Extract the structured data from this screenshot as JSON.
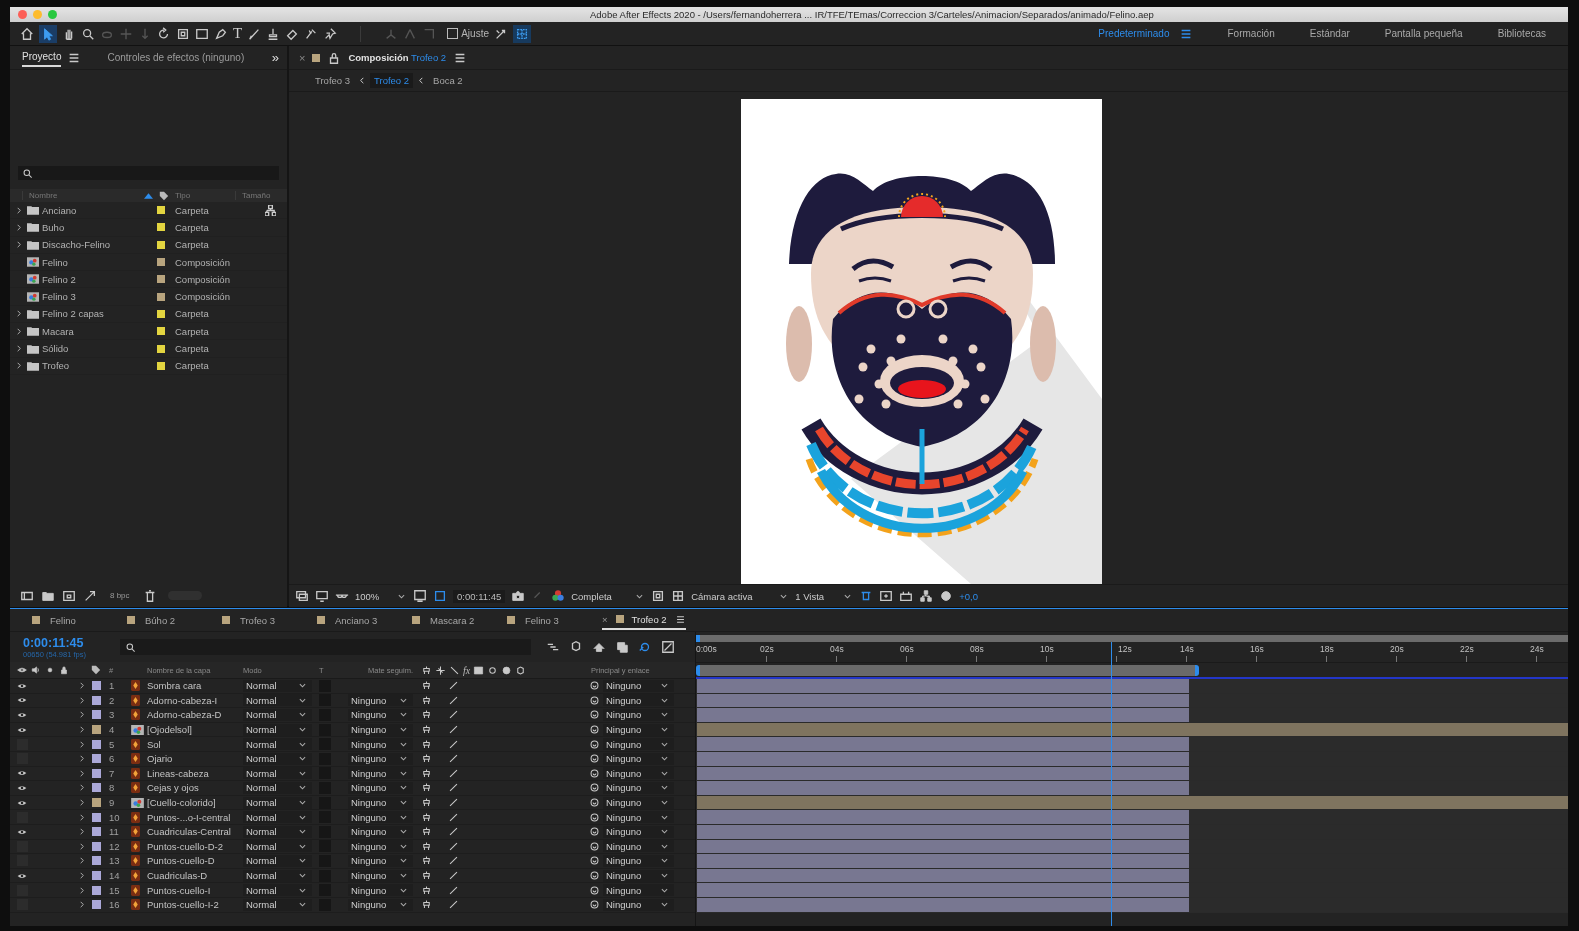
{
  "window": {
    "title": "Adobe After Effects 2020 - /Users/fernandoherrera ... IR/TFE/TEmas/Correccion 3/Carteles/Animacion/Separados/animado/Felino.aep"
  },
  "toolbar": {
    "text_tool": "T",
    "snap": {
      "label": "Ajuste",
      "checked": false
    }
  },
  "workspaces": [
    {
      "label": "Predeterminado",
      "selected": true
    },
    {
      "label": "Formación",
      "selected": false
    },
    {
      "label": "Estándar",
      "selected": false
    },
    {
      "label": "Pantalla pequeña",
      "selected": false
    },
    {
      "label": "Bibliotecas",
      "selected": false
    }
  ],
  "project_panel": {
    "tabs": [
      {
        "label": "Proyecto",
        "selected": true
      },
      {
        "label": "Controles de efectos (ninguno)",
        "selected": false
      }
    ],
    "overflow": "»",
    "columns": [
      "Nombre",
      "Tipo",
      "Tamaño"
    ],
    "items": [
      {
        "name": "Anciano",
        "kind": "folder",
        "color": "#e3d540",
        "type": "Carpeta"
      },
      {
        "name": "Buho",
        "kind": "folder",
        "color": "#e3d540",
        "type": "Carpeta"
      },
      {
        "name": "Discacho-Felino",
        "kind": "folder",
        "color": "#e3d540",
        "type": "Carpeta"
      },
      {
        "name": "Felino",
        "kind": "composition",
        "color": "#b8a47e",
        "type": "Composición"
      },
      {
        "name": "Felino 2",
        "kind": "composition",
        "color": "#b8a47e",
        "type": "Composición"
      },
      {
        "name": "Felino 3",
        "kind": "composition",
        "color": "#b8a47e",
        "type": "Composición"
      },
      {
        "name": "Felino 2 capas",
        "kind": "folder",
        "color": "#e3d540",
        "type": "Carpeta"
      },
      {
        "name": "Macara",
        "kind": "folder",
        "color": "#e3d540",
        "type": "Carpeta"
      },
      {
        "name": "Sólido",
        "kind": "folder",
        "color": "#e3d540",
        "type": "Carpeta"
      },
      {
        "name": "Trofeo",
        "kind": "folder",
        "color": "#e3d540",
        "type": "Carpeta"
      }
    ],
    "bit_depth": "8 bpc"
  },
  "composition_panel": {
    "close": "×",
    "title": "Composición",
    "name": "Trofeo 2",
    "breadcrumbs": [
      {
        "label": "Trofeo 3",
        "selected": false
      },
      {
        "label": "Trofeo 2",
        "selected": true
      },
      {
        "label": "Boca 2",
        "selected": false
      }
    ],
    "zoom": "100%",
    "timecode": "0:00:11:45",
    "resolution": "Completa",
    "camera": "Cámara activa",
    "views": "1 Vista",
    "exposure": "+0,0"
  },
  "timeline": {
    "close": "×",
    "tabs": [
      {
        "label": "Felino",
        "selected": false
      },
      {
        "label": "Búho 2",
        "selected": false
      },
      {
        "label": "Trofeo 3",
        "selected": false
      },
      {
        "label": "Anciano 3",
        "selected": false
      },
      {
        "label": "Mascara 2",
        "selected": false
      },
      {
        "label": "Felino 3",
        "selected": false
      },
      {
        "label": "Trofeo 2",
        "selected": true
      }
    ],
    "current_time": "0:00:11:45",
    "frame_info": "00650 (54.981 fps)",
    "columns": {
      "number": "#",
      "layer_name": "Nombre de la capa",
      "mode": "Modo",
      "t": "T",
      "track_matte": "Mate seguim.",
      "fx": "fx",
      "parent": "Principal y enlace"
    },
    "ruler": [
      "0:00s",
      "02s",
      "04s",
      "06s",
      "08s",
      "10s",
      "12s",
      "14s",
      "16s",
      "18s",
      "20s",
      "22s",
      "24s"
    ],
    "layers": [
      {
        "number": "1",
        "name": "Sombra cara",
        "kind": "shape",
        "visible": true,
        "color": "#aba8d8",
        "mode": "Normal",
        "parent": "Ninguno",
        "level": 0.565
      },
      {
        "number": "2",
        "name": "Adorno-cabeza-I",
        "kind": "shape",
        "visible": true,
        "color": "#aba8d8",
        "mode": "Normal",
        "track_matte": "Ninguno",
        "parent": "Ninguno",
        "level": 0.565
      },
      {
        "number": "3",
        "name": "Adorno-cabeza-D",
        "kind": "shape",
        "visible": true,
        "color": "#aba8d8",
        "mode": "Normal",
        "track_matte": "Ninguno",
        "parent": "Ninguno",
        "level": 0.565
      },
      {
        "number": "4",
        "name": "[Ojodelsol]",
        "kind": "composition",
        "visible": true,
        "color": "#b8a47e",
        "mode": "Normal",
        "track_matte": "Ninguno",
        "parent": "Ninguno",
        "level": 1
      },
      {
        "number": "5",
        "name": "Sol",
        "kind": "shape",
        "visible": false,
        "color": "#aba8d8",
        "mode": "Normal",
        "track_matte": "Ninguno",
        "parent": "Ninguno",
        "level": 0.565
      },
      {
        "number": "6",
        "name": "Ojario",
        "kind": "shape",
        "visible": false,
        "color": "#aba8d8",
        "mode": "Normal",
        "track_matte": "Ninguno",
        "parent": "Ninguno",
        "level": 0.565
      },
      {
        "number": "7",
        "name": "Lineas-cabeza",
        "kind": "shape",
        "visible": true,
        "color": "#aba8d8",
        "mode": "Normal",
        "track_matte": "Ninguno",
        "parent": "Ninguno",
        "level": 0.565
      },
      {
        "number": "8",
        "name": "Cejas y ojos",
        "kind": "shape",
        "visible": true,
        "color": "#aba8d8",
        "mode": "Normal",
        "track_matte": "Ninguno",
        "parent": "Ninguno",
        "level": 0.565
      },
      {
        "number": "9",
        "name": "[Cuello-colorido]",
        "kind": "composition",
        "visible": true,
        "color": "#b8a47e",
        "mode": "Normal",
        "track_matte": "Ninguno",
        "parent": "Ninguno",
        "level": 1
      },
      {
        "number": "10",
        "name": "Puntos-...o-I-central",
        "kind": "shape",
        "visible": false,
        "color": "#aba8d8",
        "mode": "Normal",
        "track_matte": "Ninguno",
        "parent": "Ninguno",
        "level": 0.565
      },
      {
        "number": "11",
        "name": "Cuadriculas-Central",
        "kind": "shape",
        "visible": true,
        "color": "#aba8d8",
        "mode": "Normal",
        "track_matte": "Ninguno",
        "parent": "Ninguno",
        "level": 0.565
      },
      {
        "number": "12",
        "name": "Puntos-cuello-D-2",
        "kind": "shape",
        "visible": false,
        "color": "#aba8d8",
        "mode": "Normal",
        "track_matte": "Ninguno",
        "parent": "Ninguno",
        "level": 0.565
      },
      {
        "number": "13",
        "name": "Puntos-cuello-D",
        "kind": "shape",
        "visible": false,
        "color": "#aba8d8",
        "mode": "Normal",
        "track_matte": "Ninguno",
        "parent": "Ninguno",
        "level": 0.565
      },
      {
        "number": "14",
        "name": "Cuadriculas-D",
        "kind": "shape",
        "visible": true,
        "color": "#aba8d8",
        "mode": "Normal",
        "track_matte": "Ninguno",
        "parent": "Ninguno",
        "level": 0.565
      },
      {
        "number": "15",
        "name": "Puntos-cuello-I",
        "kind": "shape",
        "visible": false,
        "color": "#aba8d8",
        "mode": "Normal",
        "track_matte": "Ninguno",
        "parent": "Ninguno",
        "level": 0.565
      },
      {
        "number": "16",
        "name": "Puntos-cuello-I-2",
        "kind": "shape",
        "visible": false,
        "color": "#aba8d8",
        "mode": "Normal",
        "track_matte": "Ninguno",
        "parent": "Ninguno",
        "level": 0.565
      }
    ]
  }
}
